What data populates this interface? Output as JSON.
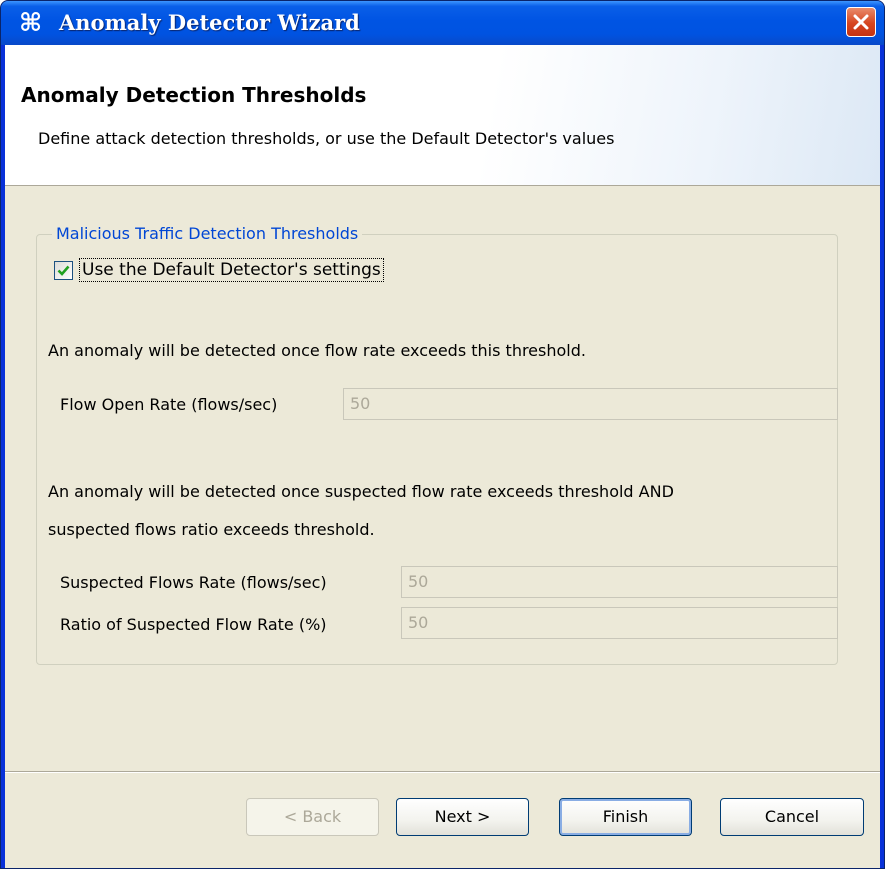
{
  "window": {
    "title": "Anomaly Detector Wizard",
    "app_icon_glyph": "⌘",
    "close_icon": "close-icon"
  },
  "header": {
    "title": "Anomaly Detection Thresholds",
    "subtitle": "Define attack detection thresholds, or use the Default Detector's values"
  },
  "group": {
    "legend": "Malicious Traffic Detection Thresholds",
    "checkbox_label": "Use the Default Detector's settings",
    "checkbox_checked": true,
    "flow_desc": "An anomaly will be detected once flow rate exceeds this threshold.",
    "flow_open_rate_label": "Flow Open Rate (flows/sec)",
    "flow_open_rate_value": "50",
    "suspected_desc_line1": "An anomaly will be detected once suspected flow rate exceeds threshold AND",
    "suspected_desc_line2": "suspected flows ratio exceeds threshold.",
    "suspected_rate_label": "Suspected Flows Rate (flows/sec)",
    "suspected_rate_value": "50",
    "ratio_label": "Ratio of Suspected Flow Rate (%)",
    "ratio_value": "50"
  },
  "buttons": {
    "back": "< Back",
    "next": "Next >",
    "finish": "Finish",
    "cancel": "Cancel"
  },
  "colors": {
    "titlebar": "#0054e3",
    "dialog_bg": "#ece9d8",
    "group_legend": "#0046d5",
    "checkmark": "#21a121"
  }
}
